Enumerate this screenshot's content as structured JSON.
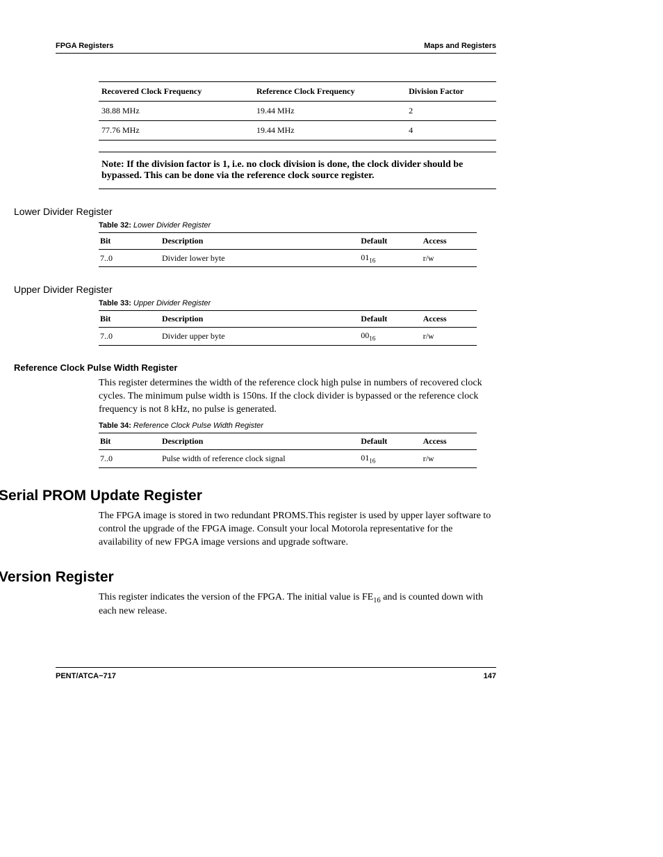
{
  "header": {
    "left": "FPGA Registers",
    "right": "Maps and Registers"
  },
  "freq_table": {
    "headers": [
      "Recovered Clock Frequency",
      "Reference Clock Frequency",
      "Division Factor"
    ],
    "rows": [
      [
        "38.88 MHz",
        "19.44 MHz",
        "2"
      ],
      [
        "77.76 MHz",
        "19.44 MHz",
        "4"
      ]
    ]
  },
  "note": "Note:  If the division factor is 1, i.e. no clock division is done, the clock divider should be bypassed. This can be done via the reference clock source register.",
  "lower_div": {
    "heading": "Lower Divider Register",
    "caption_num": "Table 32:",
    "caption_title": " Lower Divider Register",
    "headers": [
      "Bit",
      "Description",
      "Default",
      "Access"
    ],
    "row": {
      "bit": "7..0",
      "desc": "Divider lower byte",
      "def_main": "01",
      "def_sub": "16",
      "access": "r/w"
    }
  },
  "upper_div": {
    "heading": "Upper Divider Register",
    "caption_num": "Table 33:",
    "caption_title": " Upper Divider Register",
    "headers": [
      "Bit",
      "Description",
      "Default",
      "Access"
    ],
    "row": {
      "bit": "7..0",
      "desc": "Divider upper byte",
      "def_main": "00",
      "def_sub": "16",
      "access": "r/w"
    }
  },
  "ref_pulse": {
    "heading": "Reference Clock Pulse Width Register",
    "body": "This register determines the width of the reference clock high pulse in numbers of recovered clock cycles. The minimum pulse width is 150ns. If the clock divider is bypassed or the reference clock frequency is not 8 kHz, no pulse is generated.",
    "caption_num": "Table 34:",
    "caption_title": " Reference Clock Pulse Width Register",
    "headers": [
      "Bit",
      "Description",
      "Default",
      "Access"
    ],
    "row": {
      "bit": "7..0",
      "desc": "Pulse width of reference clock signal",
      "def_main": "01",
      "def_sub": "16",
      "access": "r/w"
    }
  },
  "serial_prom": {
    "heading": "Serial PROM Update Register",
    "body": "The FPGA image is stored in two redundant PROMS.This register is used by upper layer software to control the upgrade of the FPGA image. Consult your local Motorola representative for the availability of new FPGA image versions and upgrade software."
  },
  "version": {
    "heading": "Version Register",
    "body_pre": "This register indicates the version of the FPGA. The initial value is FE",
    "body_sub": "16",
    "body_post": "   and is counted down with each new release."
  },
  "footer": {
    "left": "PENT/ATCA−717",
    "right": "147"
  }
}
